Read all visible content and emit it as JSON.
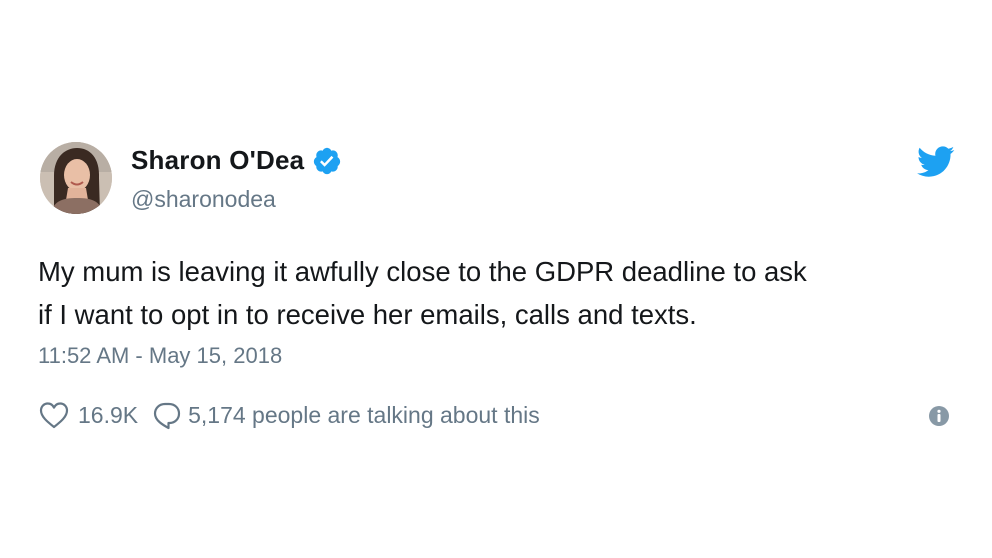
{
  "tweet": {
    "author": {
      "name": "Sharon O'Dea",
      "handle": "@sharonodea",
      "verified": true
    },
    "text_lines": [
      "My mum is leaving it awfully close to the GDPR deadline to ask",
      "if I want to opt in to receive her emails, calls and texts."
    ],
    "timestamp": "11:52 AM - May 15, 2018",
    "likes": "16.9K",
    "talking": "5,174 people are talking about this"
  },
  "icons": {
    "avatar": "avatar",
    "verified": "verified-badge-icon",
    "brand": "twitter-bird-icon",
    "like": "heart-icon",
    "reply": "speech-bubble-icon",
    "info": "info-icon"
  },
  "colors": {
    "brand": "#1da1f2",
    "text": "#14171a",
    "secondary": "#657786",
    "info": "#8899a6"
  }
}
